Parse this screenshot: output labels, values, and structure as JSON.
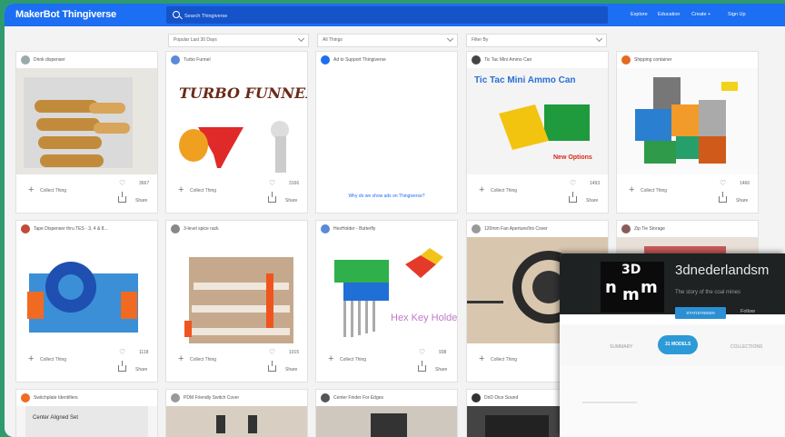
{
  "header": {
    "logo": "MakerBot Thingiverse",
    "search_placeholder": "Search Thingiverse",
    "nav": [
      "Explore",
      "Education",
      "Create +",
      "Sign Up"
    ]
  },
  "filters": [
    "Popular Last 30 Days",
    "All Things",
    "Filter By"
  ],
  "actions": {
    "collect": "Collect Thing",
    "share": "Share"
  },
  "cards": [
    {
      "title": "Drink dispenser",
      "likes": "3667"
    },
    {
      "title": "Turbo Funnel",
      "likes": "3166",
      "art_text": "TURBO FUNNEL"
    },
    {
      "title": "Ad to Support Thingiverse",
      "ad_text": "Why do we show ads on Thingiverse?"
    },
    {
      "title": "Tic Tac Mini Ammo Can",
      "likes": "1493",
      "art_text": "Tic Tac Mini Ammo Can",
      "art_sub": "New Options"
    },
    {
      "title": "Shipping container",
      "likes": "1466"
    },
    {
      "title": "Tape Dispenser thru TES - 3, 4 & 8...",
      "likes": "1118"
    },
    {
      "title": "3-level spice rack",
      "likes": "1015"
    },
    {
      "title": "HexHolder - Butterfly",
      "likes": "938",
      "art_text": "Hex Key Holder"
    },
    {
      "title": "120mm Fan Aperture/Iris Cover",
      "likes": "1311"
    },
    {
      "title": "Zip Tie Storage"
    },
    {
      "title": "Switchplate Identifiers",
      "art_text": "Center Aligned Set"
    },
    {
      "title": "PDM Friendly Switch Cover"
    },
    {
      "title": "Center Finder For Edges"
    },
    {
      "title": "DnD Dice Sound"
    }
  ],
  "overlay": {
    "logo_text": "3D",
    "logo_letters": [
      "n",
      "m",
      "m"
    ],
    "name": "3dnederlandsm",
    "subtitle": "The story of the coal mines",
    "button": "STATISTIEKEN",
    "follow": "Follow",
    "tabs": [
      "SUMMARY",
      "31 MODELS",
      "COLLECTIONS"
    ]
  },
  "colors": {
    "brand_blue": "#1c6ef2",
    "background_green": "#2e9a6e",
    "overlay_accent": "#2c9ad6"
  }
}
